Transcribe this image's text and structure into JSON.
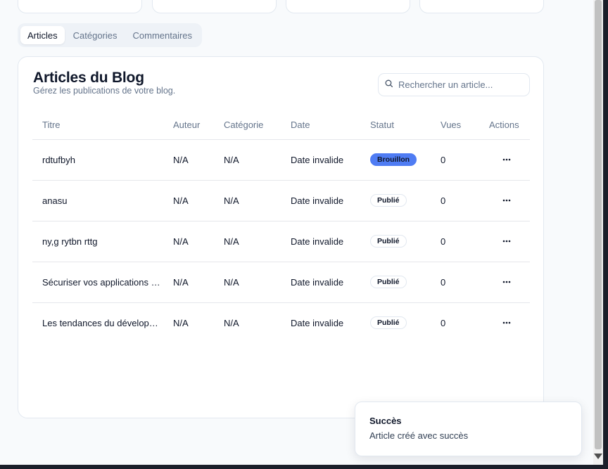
{
  "tabs": [
    {
      "label": "Articles",
      "active": true
    },
    {
      "label": "Catégories",
      "active": false
    },
    {
      "label": "Commentaires",
      "active": false
    }
  ],
  "panel": {
    "title": "Articles du Blog",
    "subtitle": "Gérez les publications de votre blog.",
    "search_placeholder": "Rechercher un article...",
    "search_value": ""
  },
  "table": {
    "columns": [
      "Titre",
      "Auteur",
      "Catégorie",
      "Date",
      "Statut",
      "Vues",
      "Actions"
    ],
    "rows": [
      {
        "title": "rdtufbyh",
        "author": "N/A",
        "category": "N/A",
        "date": "Date invalide",
        "status": "Brouillon",
        "views": "0"
      },
      {
        "title": "anasu",
        "author": "N/A",
        "category": "N/A",
        "date": "Date invalide",
        "status": "Publié",
        "views": "0"
      },
      {
        "title": "ny,g rytbn rttg",
        "author": "N/A",
        "category": "N/A",
        "date": "Date invalide",
        "status": "Publié",
        "views": "0"
      },
      {
        "title": "Sécuriser vos applications web",
        "author": "N/A",
        "category": "N/A",
        "date": "Date invalide",
        "status": "Publié",
        "views": "0"
      },
      {
        "title": "Les tendances du développement",
        "author": "N/A",
        "category": "N/A",
        "date": "Date invalide",
        "status": "Publié",
        "views": "0"
      }
    ]
  },
  "toast": {
    "title": "Succès",
    "description": "Article créé avec succès"
  },
  "colors": {
    "draft_badge": "#4f7cf3",
    "page_bg": "#f8fafc",
    "border": "#e2e8f0"
  },
  "icons": {
    "search": "search-icon",
    "row_actions": "more-horizontal-icon"
  }
}
